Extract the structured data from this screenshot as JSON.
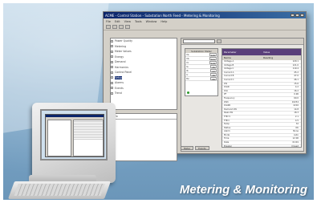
{
  "caption": "Metering & Monitoring",
  "app": {
    "title": "ACME - Control Station - Substation North Feed - Metering & Monitoring",
    "menu": [
      "File",
      "Edit",
      "View",
      "Tools",
      "Window",
      "Help"
    ],
    "tree_items": [
      {
        "label": "Power Quality"
      },
      {
        "label": "Metering"
      },
      {
        "label": "Meter Values"
      },
      {
        "label": "Energy"
      },
      {
        "label": "Demand"
      },
      {
        "label": "Harmonics"
      },
      {
        "label": "Control Panel"
      },
      {
        "label": "Setup",
        "selected": true
      },
      {
        "label": "Alarms"
      },
      {
        "label": "Events"
      },
      {
        "label": "Trend"
      }
    ],
    "bottom_pane_header": "Info",
    "meter_panel": {
      "title": "Substation Meter",
      "rows": [
        {
          "label": "Va",
          "value": "120"
        },
        {
          "label": "Vb",
          "value": "121"
        },
        {
          "label": "Vc",
          "value": "119"
        },
        {
          "label": "Ia",
          "value": "45"
        },
        {
          "label": "Ib",
          "value": "47"
        },
        {
          "label": "Ic",
          "value": "46"
        },
        {
          "label": "Hz",
          "value": "60"
        }
      ]
    },
    "table": {
      "header": [
        "Parameter",
        "Value"
      ],
      "subheader": [
        "Name",
        "Reading"
      ],
      "rows": [
        [
          "Voltage A",
          "120.1"
        ],
        [
          "Voltage B",
          "121.0"
        ],
        [
          "Voltage C",
          "119.4"
        ],
        [
          "Current A",
          "45.2"
        ],
        [
          "Current B",
          "47.0"
        ],
        [
          "Current C",
          "46.1"
        ],
        [
          "kW",
          "15.6"
        ],
        [
          "kVAR",
          "4.2"
        ],
        [
          "kVA",
          "16.2"
        ],
        [
          "PF",
          "0.96"
        ],
        [
          "Frequency",
          "60.0"
        ],
        [
          "kWh",
          "10234"
        ],
        [
          "kVARh",
          "2210"
        ],
        [
          "Demand kW",
          "14.8"
        ],
        [
          "Peak kW",
          "18.3"
        ],
        [
          "THD V",
          "2.1"
        ],
        [
          "THD I",
          "4.5"
        ],
        [
          "Temp",
          "32"
        ],
        [
          "Status",
          "OK"
        ],
        [
          "Alarm",
          "None"
        ],
        [
          "Mode",
          "Auto"
        ],
        [
          "Time",
          "12:00"
        ],
        [
          "Date",
          "01/01"
        ],
        [
          "Breaker",
          "Closed"
        ]
      ]
    },
    "status_tabs": [
      "Meter",
      "Events"
    ]
  }
}
